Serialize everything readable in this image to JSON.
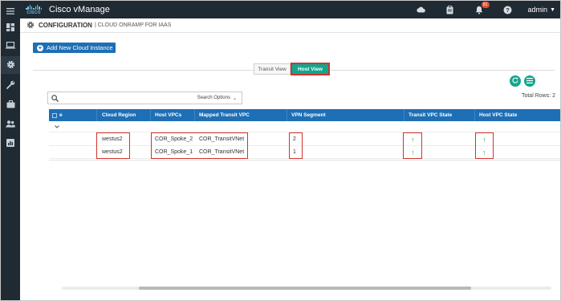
{
  "app": {
    "logo_word": "CISCO",
    "title": "Cisco vManage",
    "notifications_count": "51",
    "user": "admin",
    "colors": {
      "topbar": "#1f2a33",
      "accent": "#1e6fb5",
      "teal": "#12a68e",
      "highlight": "#d0342c",
      "state_up": "#2eaa52"
    }
  },
  "top_icons": [
    "cloud-icon",
    "clipboard-icon",
    "bell-icon",
    "help-icon"
  ],
  "sidebar": {
    "items": [
      {
        "icon": "menu-icon",
        "active": false
      },
      {
        "icon": "dashboard-icon",
        "active": false
      },
      {
        "icon": "monitor-icon",
        "active": false
      },
      {
        "icon": "gear-icon",
        "active": true
      },
      {
        "icon": "wrench-icon",
        "active": false
      },
      {
        "icon": "briefcase-icon",
        "active": false
      },
      {
        "icon": "users-icon",
        "active": false
      },
      {
        "icon": "analytics-icon",
        "active": false
      }
    ]
  },
  "breadcrumb": {
    "main": "CONFIGURATION",
    "sub": "| CLOUD ONRAMP FOR IAAS"
  },
  "toolbar": {
    "add_button": "Add New Cloud Instance"
  },
  "view_toggle": {
    "transit": "Transit View",
    "host": "Host View",
    "selected": "host"
  },
  "table": {
    "total_rows": "Total Rows: 2",
    "search_value": "",
    "search_placeholder": "",
    "search_options": "Search Options",
    "columns": [
      "e",
      "Cloud Region",
      "Host VPCs",
      "Mapped Transit VPC",
      "VPN Segment",
      "Transit VPC State",
      "Host VPC State"
    ],
    "rows": [
      {
        "region": "westus2",
        "host_vpc": "COR_Spoke_2",
        "transit_vpc": "COR_TransitVNet",
        "vpn_segment": "2",
        "transit_state": "up",
        "host_state": "up"
      },
      {
        "region": "westus2",
        "host_vpc": "COR_Spoke_1",
        "transit_vpc": "COR_TransitVNet",
        "vpn_segment": "1",
        "transit_state": "up",
        "host_state": "up"
      }
    ]
  }
}
